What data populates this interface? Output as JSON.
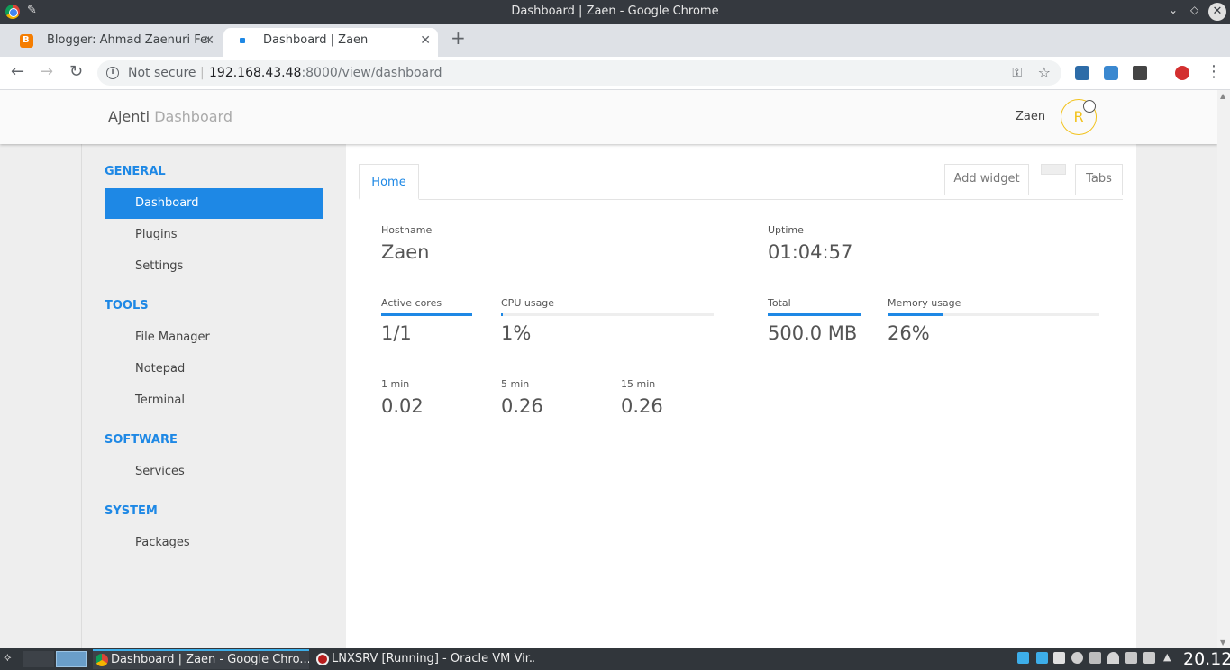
{
  "window": {
    "title": "Dashboard | Zaen - Google Chrome"
  },
  "browser": {
    "tabs": [
      {
        "label": "Blogger: Ahmad Zaenuri Ferdi"
      },
      {
        "label": "Dashboard | Zaen"
      }
    ],
    "security_label": "Not secure",
    "url_host": "192.168.43.48",
    "url_rest": ":8000/view/dashboard"
  },
  "app": {
    "brand": "Ajenti",
    "brand_sub": "Dashboard",
    "username": "Zaen",
    "avatar_letter": "R"
  },
  "sidebar": {
    "sections": [
      {
        "title": "GENERAL",
        "items": [
          "Dashboard",
          "Plugins",
          "Settings"
        ]
      },
      {
        "title": "TOOLS",
        "items": [
          "File Manager",
          "Notepad",
          "Terminal"
        ]
      },
      {
        "title": "SOFTWARE",
        "items": [
          "Services"
        ]
      },
      {
        "title": "SYSTEM",
        "items": [
          "Packages"
        ]
      }
    ],
    "active_item": "Dashboard"
  },
  "dashboard": {
    "tab_home": "Home",
    "add_widget": "Add widget",
    "tabs_button": "Tabs",
    "hostname": {
      "label": "Hostname",
      "value": "Zaen"
    },
    "uptime": {
      "label": "Uptime",
      "value": "01:04:57"
    },
    "cores": {
      "label": "Active cores",
      "value": "1/1",
      "level": 1.0
    },
    "cpu": {
      "label": "CPU usage",
      "value": "1%",
      "level": 0.01
    },
    "memory_total": {
      "label": "Total",
      "value": "500.0 MB",
      "level": 1.0
    },
    "memory_usage": {
      "label": "Memory usage",
      "value": "26%",
      "level": 0.26
    },
    "load": [
      {
        "label": "1 min",
        "value": "0.02"
      },
      {
        "label": "5 min",
        "value": "0.26"
      },
      {
        "label": "15 min",
        "value": "0.26"
      }
    ]
  },
  "taskbar": {
    "tasks": [
      {
        "label": "Dashboard | Zaen - Google Chro..."
      },
      {
        "label": "LNXSRV [Running] - Oracle VM Vir..."
      }
    ],
    "clock": "20.12"
  },
  "colors": {
    "accent": "#1e88e5",
    "avatar": "#f2c21b"
  }
}
